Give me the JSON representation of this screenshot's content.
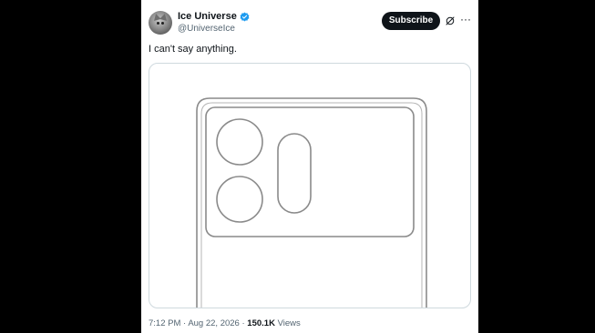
{
  "tweet": {
    "author": {
      "display_name": "Ice Universe",
      "handle": "@UniverseIce",
      "verified": true,
      "avatar": "cat-avatar"
    },
    "actions": {
      "subscribe_label": "Subscribe",
      "grok_icon": "grok-icon",
      "more_icon": "more-dots-icon",
      "more_glyph": "···"
    },
    "text": "I can't say anything.",
    "media": {
      "type": "line-drawing",
      "description_icon": "phone-camera-module-sketch"
    },
    "meta": {
      "time": "7:12 PM",
      "separator1": " · ",
      "date": "Aug 22, 2026",
      "separator2": " · ",
      "views_count": "150.1K",
      "views_label": " Views"
    }
  },
  "colors": {
    "text_primary": "#0f1419",
    "text_secondary": "#536471",
    "verified_blue": "#1d9bf0",
    "border": "#cfd9de",
    "background_outer": "#000000"
  }
}
